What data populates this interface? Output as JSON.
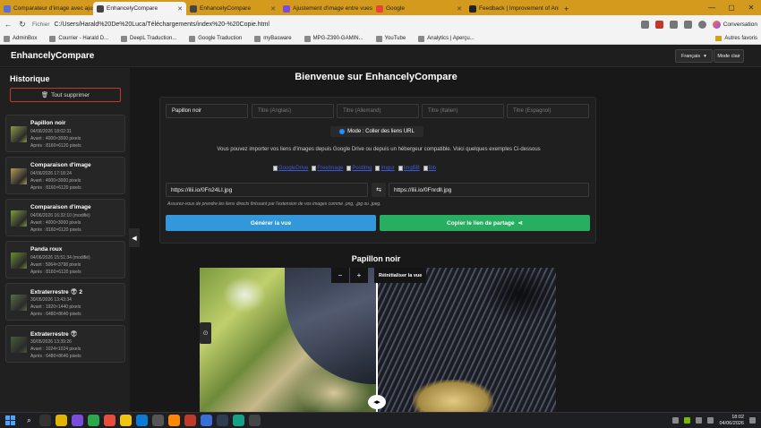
{
  "browser": {
    "tabs": [
      {
        "title": "Comparateur d'image avec ajuste...",
        "active": false,
        "color": "#5a6fd8"
      },
      {
        "title": "EnhancelyCompare",
        "active": true,
        "color": "#444444"
      },
      {
        "title": "EnhancelyCompare",
        "active": false,
        "color": "#444444"
      },
      {
        "title": "Ajustement d'image entre vues et...",
        "active": false,
        "color": "#7b4bdc"
      },
      {
        "title": "Google",
        "active": false,
        "color": "#ea4335"
      },
      {
        "title": "Feedback | Improvement of Anim...",
        "active": false,
        "color": "#222222"
      }
    ],
    "new_tab": "+",
    "address_prefix": "Fichier",
    "url": "C:/Users/Harald%20De%20Luca/Téléchargements/index%20-%20Copie.html",
    "conversation_label": "Conversation",
    "favorites": [
      "AdminBox",
      "Courrier - Harald D...",
      "DeepL Traduction...",
      "Google Traduction",
      "myBasware",
      "MPG-Z390-GAMIN...",
      "YouTube",
      "Analytics | Aperçu..."
    ],
    "other_favorites": "Autres favoris"
  },
  "app": {
    "brand": "EnhancelyCompare",
    "language": "Français",
    "mode_button": "Mode clair",
    "welcome": "Bienvenue sur EnhancelyCompare"
  },
  "sidebar": {
    "title": "Historique",
    "delete_all": "Tout supprimer",
    "items": [
      {
        "name": "Papillon noir",
        "date": "04/06/2026 18:02:31",
        "before": "Avant : 4000×3000 pixels",
        "after": "Après : 8160×6120 pixels",
        "color": "#8c9a4a"
      },
      {
        "name": "Comparaison d'image",
        "date": "04/06/2026 17:18:24",
        "before": "Avant : 4000×3000 pixels",
        "after": "Après : 8160×6120 pixels",
        "color": "#b29a5a"
      },
      {
        "name": "Comparaison d'image",
        "date": "04/06/2026 16:32:10 (modifié)",
        "before": "Avant : 4000×3000 pixels",
        "after": "Après : 8160×6120 pixels",
        "color": "#7f9a3d"
      },
      {
        "name": "Panda roux",
        "date": "04/06/2026 15:51:34 (modifié)",
        "before": "Avant : 5064×3798 pixels",
        "after": "Après : 8160×6120 pixels",
        "color": "#6b8c34"
      },
      {
        "name": "Extraterrestre 👽 2",
        "date": "30/05/2026 13:43:34",
        "before": "Avant : 1920×1440 pixels",
        "after": "Après : 6480×8640 pixels",
        "color": "#5a6a48"
      },
      {
        "name": "Extraterrestre 👽",
        "date": "30/05/2026 13:39:26",
        "before": "Avant : 1024×1024 pixels",
        "after": "Après : 6480×8640 pixels",
        "color": "#4a5a3a"
      }
    ]
  },
  "form": {
    "title_main": "Papillon noir",
    "placeholders": [
      "Titre (Anglais)",
      "Titre (Allemand)",
      "Titre (Italien)",
      "Titre (Espagnol)"
    ],
    "mode": "Mode : Coller des liens URL",
    "info": "Vous pouvez importer vos liens d'images depuis Google Drive ou depuis un hébergeur compatible. Voici quelques exemples Ci-dessous",
    "example_links": [
      "GoogleDrive",
      "FreeImage",
      "PostImg",
      "Imgur",
      "ImgBB",
      "Ibb"
    ],
    "url_before": "https://ilii.io/0Fn24LI.jpg",
    "url_after": "https://ilii.io/0Fnrdll.jpg",
    "hint": "Assurez-vous de prendre les liens directs finissant par l'extension de vos images comme .png, .jpg ou .jpeg.",
    "generate": "Générer la vue",
    "share": "Copier le lien de partage"
  },
  "viewer": {
    "title": "Papillon noir",
    "zoom_out": "−",
    "zoom_in": "+",
    "reset": "Réinitialiser la vue",
    "handle": "◂▸"
  },
  "taskbar": {
    "time": "18:02",
    "date": "04/06/2026"
  }
}
